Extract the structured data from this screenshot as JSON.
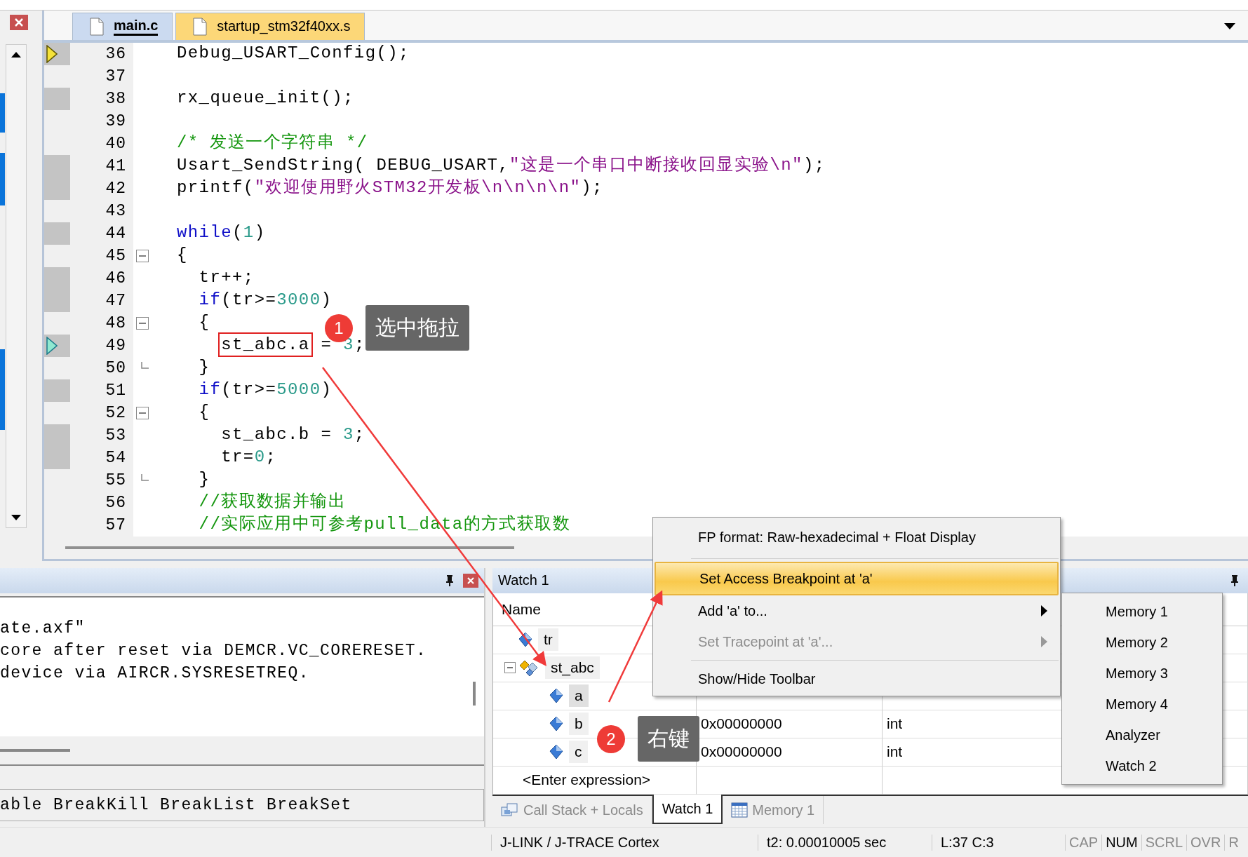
{
  "editor": {
    "tabs": [
      {
        "label": "main.c",
        "selected": true
      },
      {
        "label": "startup_stm32f40xx.s",
        "selected": false
      }
    ],
    "lines": [
      {
        "number": "36",
        "exec": true,
        "current": true,
        "caller": false,
        "fold_start": false,
        "fold_end": false,
        "tokens": [
          {
            "kind": "plain",
            "text": "Debug_USART_Config();"
          }
        ]
      },
      {
        "number": "37",
        "exec": false,
        "current": false,
        "caller": false,
        "fold_start": false,
        "fold_end": false
      },
      {
        "number": "38",
        "exec": true,
        "current": false,
        "caller": false,
        "fold_start": false,
        "fold_end": false,
        "tokens": [
          {
            "kind": "plain",
            "text": "rx_queue_init();"
          }
        ]
      },
      {
        "number": "39",
        "exec": false,
        "current": false,
        "caller": false,
        "fold_start": false,
        "fold_end": false
      },
      {
        "number": "40",
        "exec": false,
        "current": false,
        "caller": false,
        "fold_start": false,
        "fold_end": false,
        "tokens": [
          {
            "kind": "comment",
            "text": "/* 发送一个字符串 */"
          }
        ]
      },
      {
        "number": "41",
        "exec": true,
        "current": false,
        "caller": false,
        "fold_start": false,
        "fold_end": false,
        "tokens": [
          {
            "kind": "plain",
            "text": "Usart_SendString( DEBUG_USART,"
          },
          {
            "kind": "string",
            "text": "\"这是一个串口中断接收回显实验\\n\""
          },
          {
            "kind": "plain",
            "text": ");"
          }
        ]
      },
      {
        "number": "42",
        "exec": true,
        "current": false,
        "caller": false,
        "fold_start": false,
        "fold_end": false,
        "tokens": [
          {
            "kind": "plain",
            "text": "printf("
          },
          {
            "kind": "string",
            "text": "\"欢迎使用野火STM32开发板\\n\\n\\n\\n\""
          },
          {
            "kind": "plain",
            "text": ");"
          }
        ]
      },
      {
        "number": "43",
        "exec": false,
        "current": false,
        "caller": false,
        "fold_start": false,
        "fold_end": false
      },
      {
        "number": "44",
        "exec": true,
        "current": false,
        "caller": false,
        "fold_start": false,
        "fold_end": false,
        "tokens": [
          {
            "kind": "keyword",
            "text": "while"
          },
          {
            "kind": "plain",
            "text": "("
          },
          {
            "kind": "number",
            "text": "1"
          },
          {
            "kind": "plain",
            "text": ")"
          }
        ]
      },
      {
        "number": "45",
        "exec": false,
        "current": false,
        "caller": false,
        "fold_start": true,
        "fold_end": false,
        "tokens": [
          {
            "kind": "plain",
            "text": "{"
          }
        ]
      },
      {
        "number": "46",
        "exec": true,
        "current": false,
        "caller": false,
        "fold_start": false,
        "fold_end": false,
        "tokens": [
          {
            "kind": "plain",
            "text": "  tr++;"
          }
        ]
      },
      {
        "number": "47",
        "exec": true,
        "current": false,
        "caller": false,
        "fold_start": false,
        "fold_end": false,
        "tokens": [
          {
            "kind": "keyword",
            "text": "  if"
          },
          {
            "kind": "plain",
            "text": "(tr>="
          },
          {
            "kind": "number",
            "text": "3000"
          },
          {
            "kind": "plain",
            "text": ")"
          }
        ]
      },
      {
        "number": "48",
        "exec": false,
        "current": false,
        "caller": false,
        "fold_start": true,
        "fold_end": false,
        "tokens": [
          {
            "kind": "plain",
            "text": "  {"
          }
        ]
      },
      {
        "number": "49",
        "exec": true,
        "current": false,
        "caller": true,
        "fold_start": false,
        "fold_end": false,
        "tokens": [
          {
            "kind": "marked",
            "text": "    st_abc.a"
          },
          {
            "kind": "plain",
            "text": " = "
          },
          {
            "kind": "number",
            "text": "3"
          },
          {
            "kind": "plain",
            "text": ";"
          }
        ]
      },
      {
        "number": "50",
        "exec": false,
        "current": false,
        "caller": false,
        "fold_start": false,
        "fold_end": true,
        "tokens": [
          {
            "kind": "plain",
            "text": "  }"
          }
        ]
      },
      {
        "number": "51",
        "exec": true,
        "current": false,
        "caller": false,
        "fold_start": false,
        "fold_end": false,
        "tokens": [
          {
            "kind": "keyword",
            "text": "  if"
          },
          {
            "kind": "plain",
            "text": "(tr>="
          },
          {
            "kind": "number",
            "text": "5000"
          },
          {
            "kind": "plain",
            "text": ")"
          }
        ]
      },
      {
        "number": "52",
        "exec": false,
        "current": false,
        "caller": false,
        "fold_start": true,
        "fold_end": false,
        "tokens": [
          {
            "kind": "plain",
            "text": "  {"
          }
        ]
      },
      {
        "number": "53",
        "exec": true,
        "current": false,
        "caller": false,
        "fold_start": false,
        "fold_end": false,
        "tokens": [
          {
            "kind": "plain",
            "text": "    st_abc.b = "
          },
          {
            "kind": "number",
            "text": "3"
          },
          {
            "kind": "plain",
            "text": ";"
          }
        ]
      },
      {
        "number": "54",
        "exec": true,
        "current": false,
        "caller": false,
        "fold_start": false,
        "fold_end": false,
        "tokens": [
          {
            "kind": "plain",
            "text": "    tr="
          },
          {
            "kind": "number",
            "text": "0"
          },
          {
            "kind": "plain",
            "text": ";"
          }
        ]
      },
      {
        "number": "55",
        "exec": false,
        "current": false,
        "caller": false,
        "fold_start": false,
        "fold_end": true,
        "tokens": [
          {
            "kind": "plain",
            "text": "  }"
          }
        ]
      },
      {
        "number": "56",
        "exec": false,
        "current": false,
        "caller": false,
        "fold_start": false,
        "fold_end": false,
        "tokens": [
          {
            "kind": "comment",
            "text": "  //获取数据并输出"
          }
        ]
      },
      {
        "number": "57",
        "exec": false,
        "current": false,
        "caller": false,
        "fold_start": false,
        "fold_end": false,
        "tokens": [
          {
            "kind": "comment",
            "text": "  //实际应用中可参考pull_data的方式获取数"
          }
        ]
      }
    ]
  },
  "output": {
    "lines": [
      "ate.axf\"",
      "core after reset via DEMCR.VC_CORERESET.",
      "device via AIRCR.SYSRESETREQ."
    ],
    "command": "able BreakKill BreakList BreakSet"
  },
  "watch": {
    "title": "Watch 1",
    "columns": [
      "Name"
    ],
    "rows": [
      {
        "name": "tr",
        "kind": "var",
        "selected": false
      },
      {
        "name": "st_abc",
        "kind": "struct",
        "selected": false,
        "expanded": true,
        "children": [
          {
            "name": "a",
            "kind": "var",
            "selected": true
          },
          {
            "name": "b",
            "kind": "var",
            "selected": false,
            "value": "0x00000000",
            "type": "int"
          },
          {
            "name": "c",
            "kind": "var",
            "selected": false,
            "value": "0x00000000",
            "type": "int"
          }
        ]
      }
    ],
    "enter": "<Enter expression>",
    "tabs": [
      {
        "label": "Call Stack + Locals",
        "kind": "stack",
        "selected": false
      },
      {
        "label": "Watch 1",
        "kind": "plain",
        "selected": true
      },
      {
        "label": "Memory 1",
        "kind": "memory",
        "selected": false
      }
    ]
  },
  "context_menu": {
    "items": [
      {
        "kind": "item",
        "label": "FP format: Raw-hexadecimal + Float Display",
        "selected": false,
        "disabled": false,
        "submenu": false
      },
      {
        "kind": "separator"
      },
      {
        "kind": "item",
        "label": "Set Access Breakpoint at 'a'",
        "selected": true,
        "disabled": false,
        "submenu": false
      },
      {
        "kind": "item",
        "label": "Add 'a' to...",
        "selected": false,
        "disabled": false,
        "submenu": true
      },
      {
        "kind": "item",
        "label": "Set Tracepoint at 'a'...",
        "selected": false,
        "disabled": true,
        "submenu": true
      },
      {
        "kind": "separator"
      },
      {
        "kind": "item",
        "label": "Show/Hide Toolbar",
        "selected": false,
        "disabled": false,
        "submenu": false
      }
    ],
    "submenu_items": [
      "Memory 1",
      "Memory 2",
      "Memory 3",
      "Memory 4",
      "Analyzer",
      "Watch 2"
    ]
  },
  "annotations": [
    {
      "number": "1",
      "text": "选中拖拉"
    },
    {
      "number": "2",
      "text": "右键"
    }
  ],
  "status": {
    "items": [
      "J-LINK / J-TRACE Cortex",
      "t2: 0.00010005 sec",
      "L:37 C:3"
    ],
    "indicators": [
      {
        "label": "CAP",
        "on": false
      },
      {
        "label": "NUM",
        "on": true
      },
      {
        "label": "SCRL",
        "on": false
      },
      {
        "label": "OVR",
        "on": false
      },
      {
        "label": "R",
        "on": false
      }
    ]
  }
}
